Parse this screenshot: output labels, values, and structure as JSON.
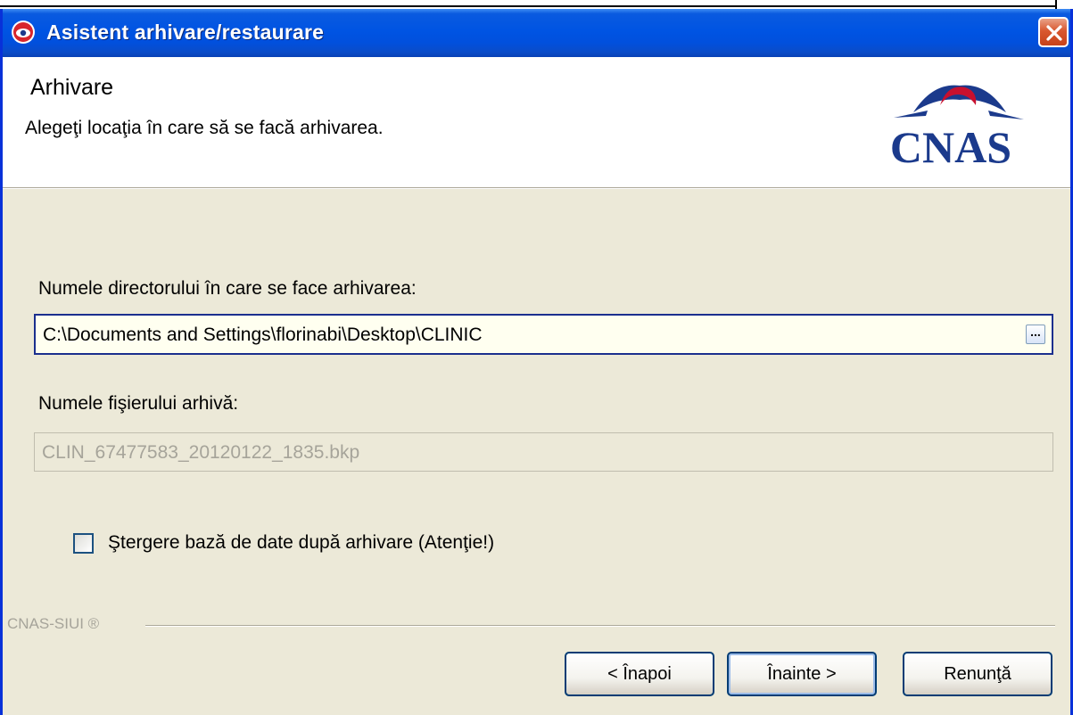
{
  "window": {
    "title": "Asistent arhivare/restaurare"
  },
  "header": {
    "title": "Arhivare",
    "subtitle": "Alegeţi locaţia în care să se facă arhivarea.",
    "logo_text": "CNAS"
  },
  "form": {
    "dir_label": "Numele directorului în care se face arhivarea:",
    "dir_value": "C:\\Documents and Settings\\florinabi\\Desktop\\CLINIC",
    "browse_label": "...",
    "file_label": "Numele fişierului arhivă:",
    "file_value": "CLIN_67477583_20120122_1835.bkp",
    "delete_checkbox_label": "Ştergere bază de date după arhivare (Atenţie!)",
    "delete_checked": false
  },
  "footer": {
    "brand": "CNAS-SIUI ®",
    "back_label": "< Înapoi",
    "next_label": "Înainte >",
    "cancel_label": "Renunţă"
  },
  "colors": {
    "titlebar": "#0054E3",
    "dialog_bg": "#ECE9D8",
    "logo_blue": "#1B3A8C",
    "logo_red": "#C8102E"
  }
}
